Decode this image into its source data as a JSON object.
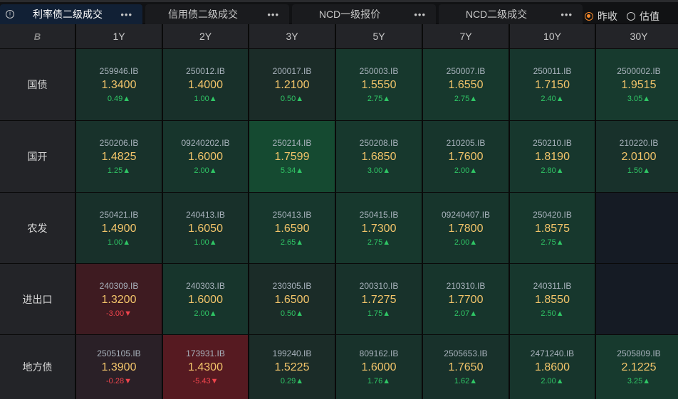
{
  "tabs": [
    {
      "label": "利率债二级成交",
      "active": true
    },
    {
      "label": "信用债二级成交",
      "active": false
    },
    {
      "label": "NCD一级报价",
      "active": false
    },
    {
      "label": "NCD二级成交",
      "active": false
    }
  ],
  "more_label": "•••",
  "info_icon": "!",
  "radios": [
    {
      "label": "昨收",
      "checked": true
    },
    {
      "label": "估值",
      "checked": false
    }
  ],
  "logo": "B",
  "columns": [
    "1Y",
    "2Y",
    "3Y",
    "5Y",
    "7Y",
    "10Y",
    "30Y"
  ],
  "colors": {
    "up": "#2fc565",
    "down": "#f0444c",
    "value": "#f2c46a",
    "accent": "#f5892a"
  },
  "rows": [
    {
      "label": "国债",
      "cells": [
        {
          "code": "259946.IB",
          "value": "1.3400",
          "change": "0.49",
          "dir": "up",
          "bg": "#18302a"
        },
        {
          "code": "250012.IB",
          "value": "1.4000",
          "change": "1.00",
          "dir": "up",
          "bg": "#18302a"
        },
        {
          "code": "200017.IB",
          "value": "1.2100",
          "change": "0.50",
          "dir": "up",
          "bg": "#1b2c28"
        },
        {
          "code": "250003.IB",
          "value": "1.5550",
          "change": "2.75",
          "dir": "up",
          "bg": "#17382d"
        },
        {
          "code": "250007.IB",
          "value": "1.6550",
          "change": "2.75",
          "dir": "up",
          "bg": "#17382d"
        },
        {
          "code": "250011.IB",
          "value": "1.7150",
          "change": "2.40",
          "dir": "up",
          "bg": "#17362d"
        },
        {
          "code": "2500002.IB",
          "value": "1.9515",
          "change": "3.05",
          "dir": "up",
          "bg": "#173a2e"
        }
      ]
    },
    {
      "label": "国开",
      "cells": [
        {
          "code": "250206.IB",
          "value": "1.4825",
          "change": "1.25",
          "dir": "up",
          "bg": "#18322b"
        },
        {
          "code": "09240202.IB",
          "value": "1.6000",
          "change": "2.00",
          "dir": "up",
          "bg": "#17352c"
        },
        {
          "code": "250214.IB",
          "value": "1.7599",
          "change": "5.34",
          "dir": "up",
          "bg": "#154a31"
        },
        {
          "code": "250208.IB",
          "value": "1.6850",
          "change": "3.00",
          "dir": "up",
          "bg": "#17382d"
        },
        {
          "code": "210205.IB",
          "value": "1.7600",
          "change": "2.00",
          "dir": "up",
          "bg": "#17352c"
        },
        {
          "code": "250210.IB",
          "value": "1.8190",
          "change": "2.80",
          "dir": "up",
          "bg": "#17372d"
        },
        {
          "code": "210220.IB",
          "value": "2.0100",
          "change": "1.50",
          "dir": "up",
          "bg": "#18312b"
        }
      ]
    },
    {
      "label": "农发",
      "cells": [
        {
          "code": "250421.IB",
          "value": "1.4900",
          "change": "1.00",
          "dir": "up",
          "bg": "#18302a"
        },
        {
          "code": "240413.IB",
          "value": "1.6050",
          "change": "1.00",
          "dir": "up",
          "bg": "#18302a"
        },
        {
          "code": "250413.IB",
          "value": "1.6590",
          "change": "2.65",
          "dir": "up",
          "bg": "#17372d"
        },
        {
          "code": "250415.IB",
          "value": "1.7300",
          "change": "2.75",
          "dir": "up",
          "bg": "#17382d"
        },
        {
          "code": "09240407.IB",
          "value": "1.7800",
          "change": "2.00",
          "dir": "up",
          "bg": "#17352c"
        },
        {
          "code": "250420.IB",
          "value": "1.8575",
          "change": "2.75",
          "dir": "up",
          "bg": "#17382d"
        },
        {
          "code": "",
          "value": "",
          "change": "",
          "dir": "",
          "bg": "#151b24"
        }
      ]
    },
    {
      "label": "进出口",
      "cells": [
        {
          "code": "240309.IB",
          "value": "1.3200",
          "change": "-3.00",
          "dir": "down",
          "bg": "#3e1b21"
        },
        {
          "code": "240303.IB",
          "value": "1.6000",
          "change": "2.00",
          "dir": "up",
          "bg": "#17352c"
        },
        {
          "code": "230305.IB",
          "value": "1.6500",
          "change": "0.50",
          "dir": "up",
          "bg": "#1b2c28"
        },
        {
          "code": "200310.IB",
          "value": "1.7275",
          "change": "1.75",
          "dir": "up",
          "bg": "#18322b"
        },
        {
          "code": "210310.IB",
          "value": "1.7700",
          "change": "2.07",
          "dir": "up",
          "bg": "#17352c"
        },
        {
          "code": "240311.IB",
          "value": "1.8550",
          "change": "2.50",
          "dir": "up",
          "bg": "#17372d"
        },
        {
          "code": "",
          "value": "",
          "change": "",
          "dir": "",
          "bg": "#151b24"
        }
      ]
    },
    {
      "label": "地方债",
      "cells": [
        {
          "code": "2505105.IB",
          "value": "1.3900",
          "change": "-0.28",
          "dir": "down",
          "bg": "#2a2027"
        },
        {
          "code": "173931.IB",
          "value": "1.4300",
          "change": "-5.43",
          "dir": "down",
          "bg": "#561a21"
        },
        {
          "code": "199240.IB",
          "value": "1.5225",
          "change": "0.29",
          "dir": "up",
          "bg": "#1b2c28"
        },
        {
          "code": "809162.IB",
          "value": "1.6000",
          "change": "1.76",
          "dir": "up",
          "bg": "#18322b"
        },
        {
          "code": "2505653.IB",
          "value": "1.7650",
          "change": "1.62",
          "dir": "up",
          "bg": "#18312b"
        },
        {
          "code": "2471240.IB",
          "value": "1.8600",
          "change": "2.00",
          "dir": "up",
          "bg": "#17352c"
        },
        {
          "code": "2505809.IB",
          "value": "2.1225",
          "change": "3.25",
          "dir": "up",
          "bg": "#173a2e"
        }
      ]
    }
  ]
}
